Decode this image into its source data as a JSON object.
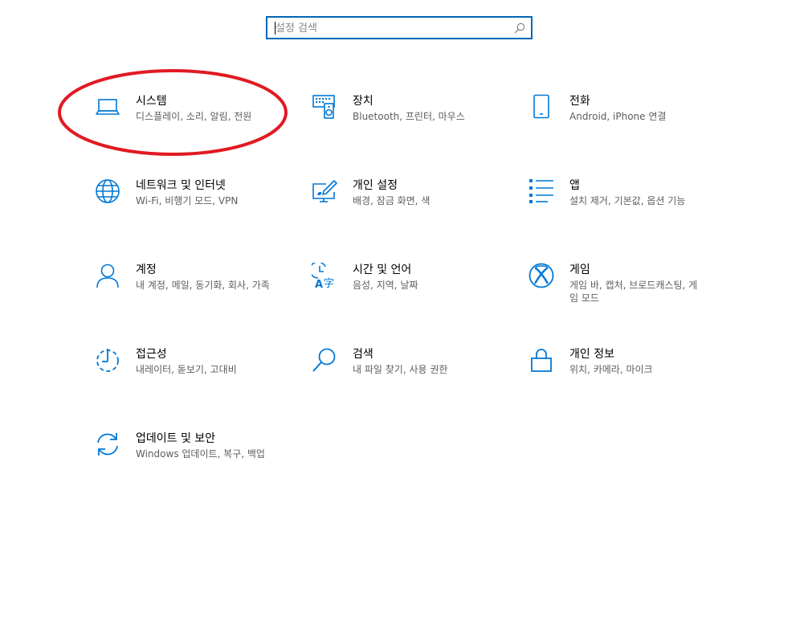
{
  "search": {
    "placeholder": "설정 검색",
    "icon": "search-icon"
  },
  "accent_color": "#0078d7",
  "annotation_color": "#e81123",
  "tiles": [
    {
      "name": "system",
      "icon": "laptop-icon",
      "title": "시스템",
      "desc": "디스플레이, 소리, 알림, 전원"
    },
    {
      "name": "devices",
      "icon": "keyboard-speaker-icon",
      "title": "장치",
      "desc": "Bluetooth, 프린터, 마우스"
    },
    {
      "name": "phone",
      "icon": "phone-icon",
      "title": "전화",
      "desc": "Android, iPhone 연결"
    },
    {
      "name": "network",
      "icon": "globe-icon",
      "title": "네트워크 및 인터넷",
      "desc": "Wi-Fi, 비행기 모드, VPN"
    },
    {
      "name": "personalization",
      "icon": "paint-pen-monitor-icon",
      "title": "개인 설정",
      "desc": "배경, 잠금 화면, 색"
    },
    {
      "name": "apps",
      "icon": "app-list-icon",
      "title": "앱",
      "desc": "설치 제거, 기본값, 옵션 기능"
    },
    {
      "name": "accounts",
      "icon": "person-icon",
      "title": "계정",
      "desc": "내 계정, 메일, 동기화, 회사, 가족"
    },
    {
      "name": "time-language",
      "icon": "clock-language-icon",
      "title": "시간 및 언어",
      "desc": "음성, 지역, 날짜"
    },
    {
      "name": "gaming",
      "icon": "xbox-icon",
      "title": "게임",
      "desc": "게임 바, 캡처, 브로드캐스팅, 게임 모드"
    },
    {
      "name": "ease-of-access",
      "icon": "ease-of-access-timer-icon",
      "title": "접근성",
      "desc": "내레이터, 돋보기, 고대비"
    },
    {
      "name": "search",
      "icon": "magnifier-icon",
      "title": "검색",
      "desc": "내 파일 찾기, 사용 권한"
    },
    {
      "name": "privacy",
      "icon": "lock-icon",
      "title": "개인 정보",
      "desc": "위치, 카메라, 마이크"
    },
    {
      "name": "update-security",
      "icon": "sync-arrows-icon",
      "title": "업데이트 및 보안",
      "desc": "Windows 업데이트, 복구, 백업"
    }
  ]
}
